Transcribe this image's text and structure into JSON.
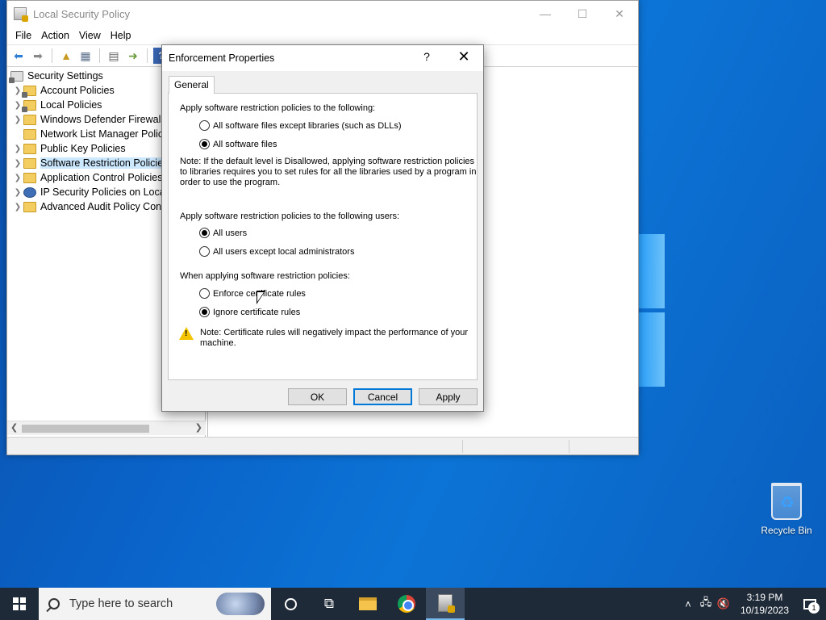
{
  "window": {
    "title": "Local Security Policy",
    "menus": [
      "File",
      "Action",
      "View",
      "Help"
    ]
  },
  "tree": {
    "root": "Security Settings",
    "items": [
      {
        "label": "Account Policies"
      },
      {
        "label": "Local Policies"
      },
      {
        "label": "Windows Defender Firewall w"
      },
      {
        "label": "Network List Manager Polici"
      },
      {
        "label": "Public Key Policies"
      },
      {
        "label": "Software Restriction Policies"
      },
      {
        "label": "Application Control Policies"
      },
      {
        "label": "IP Security Policies on Local"
      },
      {
        "label": "Advanced Audit Policy Conf"
      }
    ],
    "selected": "Software Restriction Policies"
  },
  "dialog": {
    "title": "Enforcement Properties",
    "help_glyph": "?",
    "close_glyph": "✕",
    "tab": "General",
    "section1_label": "Apply software restriction policies to the following:",
    "opt_except_libraries": "All software files except libraries (such as DLLs)",
    "opt_all_files": "All software files",
    "note1_line1": "Note:  If the default level is Disallowed, applying software restriction policies",
    "note1_line2": "to libraries requires you to set rules for all the libraries used by a program in",
    "note1_line3": "order to use the program.",
    "section2_label": "Apply software restriction policies to the following users:",
    "opt_all_users": "All users",
    "opt_except_admins": "All users except local administrators",
    "section3_label": "When applying software restriction policies:",
    "opt_enforce_cert": "Enforce certificate rules",
    "opt_ignore_cert": "Ignore certificate rules",
    "note2_line1": "Note:  Certificate rules will negatively impact the performance of your",
    "note2_line2": "machine.",
    "selected": {
      "files": "All software files",
      "users": "All users",
      "certificates": "Ignore certificate rules"
    },
    "buttons": {
      "ok": "OK",
      "cancel": "Cancel",
      "apply": "Apply"
    }
  },
  "desktop": {
    "recycle_bin": "Recycle Bin"
  },
  "taskbar": {
    "search_placeholder": "Type here to search",
    "time": "3:19 PM",
    "date": "10/19/2023",
    "notification_count": "1",
    "icons": [
      "start-icon",
      "search-icon",
      "cortana-icon",
      "task-view-icon",
      "file-explorer-icon",
      "chrome-icon",
      "local-security-policy-icon"
    ]
  }
}
